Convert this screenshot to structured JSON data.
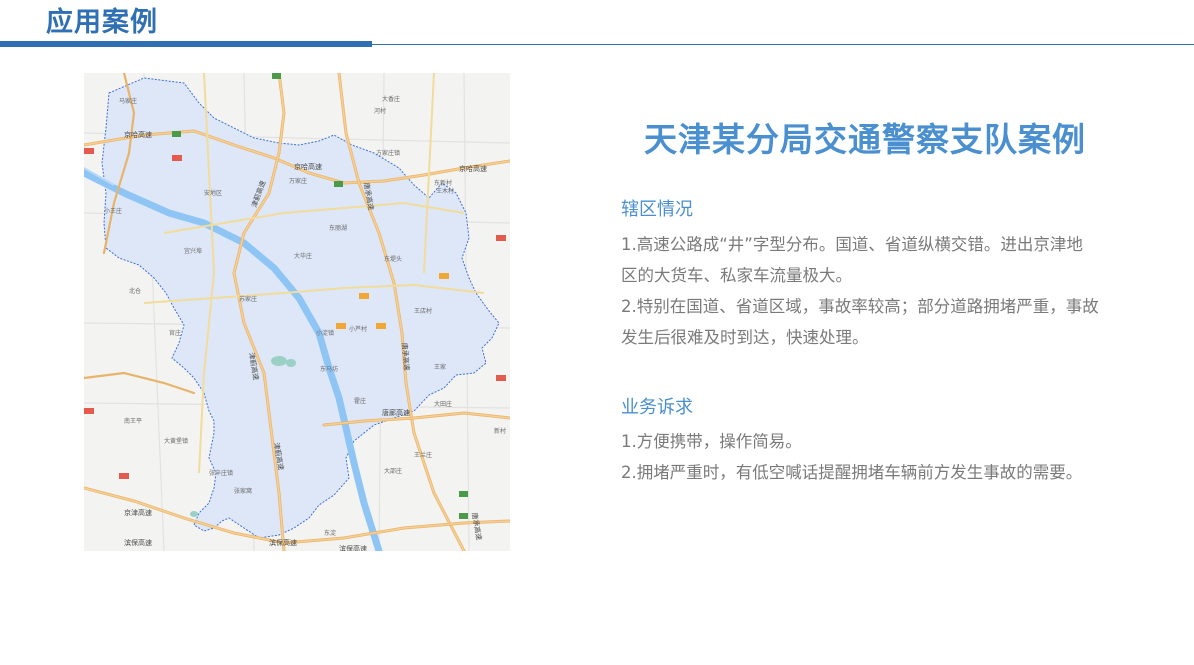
{
  "header": {
    "title": "应用案例",
    "accent_color": "#2f6fb3"
  },
  "case": {
    "title": "天津某分局交通警察支队案例",
    "title_color": "#4a8fd0"
  },
  "map": {
    "area_label": "安地区",
    "roads": {
      "jingha": "京哈高速",
      "jinglang": "津蓟高速",
      "tangcheng": "唐承高速",
      "tanglang": "唐廊高速",
      "jinggjin": "京津高速",
      "binbao": "滨保高速"
    },
    "places": {
      "p1": "大香庄",
      "p2": "河村",
      "p3": "方家庄镇",
      "p4": "王木村",
      "p5": "万家庄",
      "p6": "东丽湖",
      "p7": "大毕庄",
      "p8": "东堤头",
      "p9": "宜兴埠",
      "p10": "大黄堡镇",
      "p11": "张辛庄镇",
      "p12": "王家",
      "p13": "小淀镇",
      "p14": "南王平",
      "p15": "大田庄",
      "p16": "王兰庄",
      "p17": "大邵庄",
      "p18": "东马坊",
      "p19": "苏家庄",
      "p20": "官庄",
      "p21": "北仓",
      "p22": "霍庄",
      "p23": "张家窝",
      "p24": "小芦村",
      "p25": "王店村",
      "p26": "马家庄",
      "p27": "新村",
      "p28": "东新村",
      "p29": "小王庄",
      "p30": "东淀"
    },
    "water_color": "#8ec5f5",
    "region_fill": "#dde7f7",
    "border_color": "#3f6fd8"
  },
  "sections": [
    {
      "heading": "辖区情况",
      "lines": [
        "1.高速公路成“井”字型分布。国道、省道纵横交错。进出京津地",
        "区的大货车、私家车流量极大。",
        "2.特别在国道、省道区域，事故率较高；部分道路拥堵严重，事故",
        "发生后很难及时到达，快速处理。"
      ]
    },
    {
      "heading": "业务诉求",
      "lines": [
        "1.方便携带，操作简易。",
        "2.拥堵严重时，有低空喊话提醒拥堵车辆前方发生事故的需要。"
      ]
    }
  ]
}
